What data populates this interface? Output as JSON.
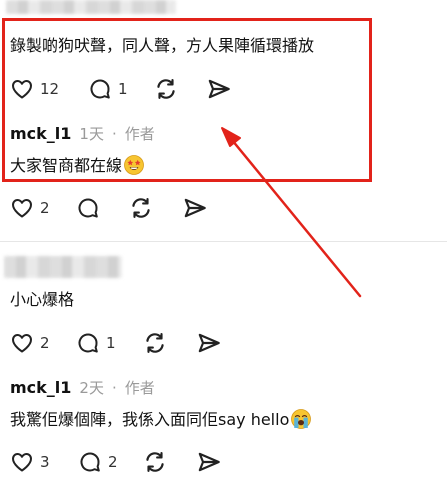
{
  "comments": {
    "c1": {
      "text": "錄製啲狗吠聲，同人聲，方人果陣循環播放",
      "likes": "12",
      "replies": "1"
    },
    "c1_reply": {
      "username": "mck_l1",
      "time": "1天",
      "separator": "·",
      "role": "作者",
      "text": "大家智商都在線",
      "emoji": "star-struck-emoji",
      "likes": "2"
    },
    "c2": {
      "text": "小心爆格",
      "likes": "2",
      "replies": "1"
    },
    "c2_reply": {
      "username": "mck_l1",
      "time": "2天",
      "separator": "·",
      "role": "作者",
      "text": "我驚佢爆個陣，我係入面同佢say hello",
      "emoji": "loudly-crying-emoji",
      "likes": "3",
      "replies": "2"
    }
  },
  "annotation": {
    "color": "#e2231a"
  },
  "icons": [
    "heart-icon",
    "comment-icon",
    "repost-icon",
    "share-icon"
  ]
}
